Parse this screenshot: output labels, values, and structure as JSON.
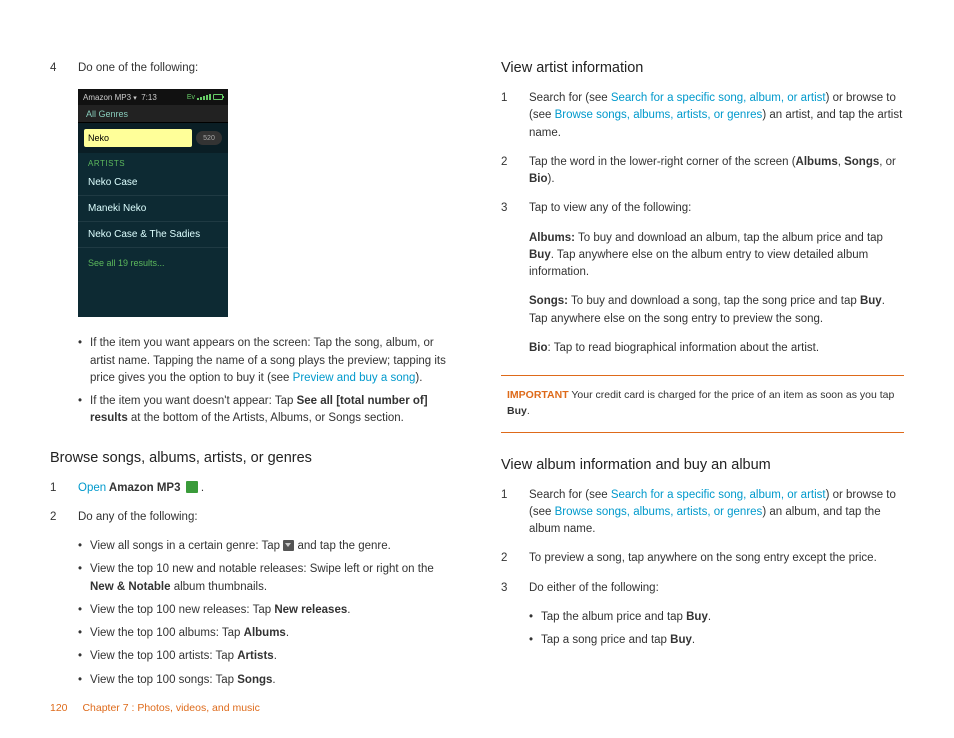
{
  "left": {
    "step4_num": "4",
    "step4_text": "Do one of the following:",
    "screenshot": {
      "app": "Amazon MP3",
      "time": "7:13",
      "genres": "All Genres",
      "search": "Neko",
      "pill": "520",
      "artists_label": "ARTISTS",
      "rows": [
        "Neko Case",
        "Maneki Neko",
        "Neko Case & The Sadies"
      ],
      "seeall": "See all 19 results..."
    },
    "bul1_a": "If the item you want appears on the screen: Tap the song, album, or artist name. Tapping the name of a song plays the preview; tapping its price gives you the option to buy it (see ",
    "bul1_link": "Preview and buy a song",
    "bul1_b": ").",
    "bul2_a": "If the item you want doesn't appear: Tap ",
    "bul2_b": "See all [total number of] results",
    "bul2_c": " at the bottom of the Artists, Albums, or Songs section.",
    "h2_browse": "Browse songs, albums, artists, or genres",
    "s1_num": "1",
    "s1_open": "Open",
    "s1_app": " Amazon MP3",
    "s1_period": " .",
    "s2_num": "2",
    "s2_text": "Do any of the following:",
    "b1_a": "View all songs in a certain genre: Tap ",
    "b1_b": " and tap the genre.",
    "b2_a": "View the top 10 new and notable releases: Swipe left or right on the ",
    "b2_b": "New & Notable",
    "b2_c": " album thumbnails.",
    "b3_a": "View the top 100 new releases: Tap ",
    "b3_b": "New releases",
    "b3_c": ".",
    "b4_a": "View the top 100 albums: Tap ",
    "b4_b": "Albums",
    "b4_c": ".",
    "b5_a": "View the top 100 artists: Tap ",
    "b5_b": "Artists",
    "b5_c": ".",
    "b6_a": "View the top 100 songs: Tap ",
    "b6_b": "Songs",
    "b6_c": "."
  },
  "right": {
    "h2_artist": "View artist information",
    "a1_num": "1",
    "a1_a": "Search for (see ",
    "a1_link1": "Search for a specific song, album, or artist",
    "a1_b": ") or browse to (see ",
    "a1_link2": "Browse songs, albums, artists, or genres",
    "a1_c": ") an artist, and tap the artist name.",
    "a2_num": "2",
    "a2_a": "Tap the word in the lower-right corner of the screen (",
    "a2_b1": "Albums",
    "a2_s1": ", ",
    "a2_b2": "Songs",
    "a2_s2": ", or ",
    "a2_b3": "Bio",
    "a2_c": ").",
    "a3_num": "3",
    "a3_text": "Tap to view any of the following:",
    "alb_b": "Albums:",
    "alb_t": " To buy and download an album, tap the album price and tap ",
    "alb_buy": "Buy",
    "alb_t2": ". Tap anywhere else on the album entry to view detailed album information.",
    "sng_b": "Songs:",
    "sng_t": " To buy and download a song, tap the song price and tap ",
    "sng_buy": "Buy",
    "sng_t2": ". Tap anywhere else on the song entry to preview the song.",
    "bio_b": "Bio",
    "bio_t": ": Tap to read biographical information about the artist.",
    "imp_label": "IMPORTANT",
    "imp_a": "   Your credit card is charged for the price of an item as soon as you tap ",
    "imp_buy": "Buy",
    "imp_b": ".",
    "h2_album": "View album information and buy an album",
    "v1_num": "1",
    "v1_a": "Search for (see ",
    "v1_link1": "Search for a specific song, album, or artist",
    "v1_b": ") or browse to (see ",
    "v1_link2": "Browse songs, albums, artists, or genres",
    "v1_c": ") an album, and tap the album name.",
    "v2_num": "2",
    "v2_text": "To preview a song, tap anywhere on the song entry except the price.",
    "v3_num": "3",
    "v3_text": "Do either of the following:",
    "vb1_a": "Tap the album price and tap ",
    "vb1_b": "Buy",
    "vb1_c": ".",
    "vb2_a": "Tap a song price and tap ",
    "vb2_b": "Buy",
    "vb2_c": "."
  },
  "footer": {
    "page": "120",
    "chapter": "Chapter 7  :  Photos, videos, and music"
  }
}
